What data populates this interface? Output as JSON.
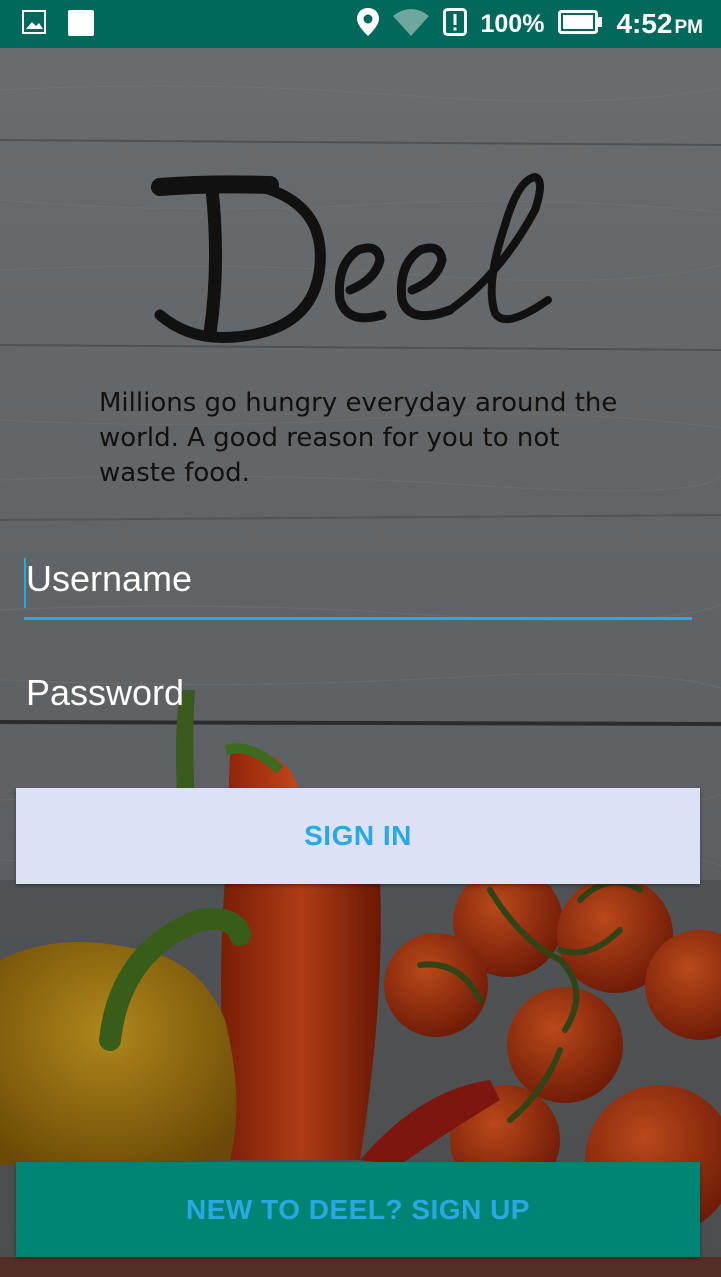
{
  "status_bar": {
    "battery_percent": "100%",
    "time": "4:52",
    "time_suffix": "PM",
    "icons": [
      "image-icon",
      "square-icon",
      "location-icon",
      "wifi-icon",
      "alert-icon",
      "battery-icon"
    ]
  },
  "logo": {
    "text": "Deel"
  },
  "tagline": "Millions go hungry everyday around the world. A good reason for you to not waste food.",
  "form": {
    "username_placeholder": "Username",
    "password_placeholder": "Password"
  },
  "buttons": {
    "sign_in": "SIGN IN",
    "sign_up": "NEW TO DEEL? SIGN UP"
  },
  "colors": {
    "status_bar": "#00695c",
    "accent": "#29a8e4",
    "sign_in_bg": "#dce1f5",
    "sign_up_bg": "#008575"
  }
}
